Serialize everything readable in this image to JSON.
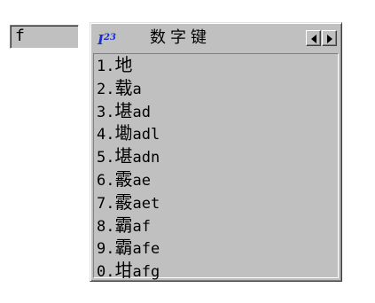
{
  "composition": {
    "text": "f"
  },
  "candidate_window": {
    "mode_icon_base": "I",
    "mode_icon_sup": "23",
    "title": "数字键",
    "nav": {
      "prev_icon": "triangle-left-icon",
      "next_icon": "triangle-right-icon"
    },
    "candidates": [
      {
        "num": "1.",
        "char": "地",
        "code": ""
      },
      {
        "num": "2.",
        "char": "载",
        "code": "a"
      },
      {
        "num": "3.",
        "char": "堪",
        "code": "ad"
      },
      {
        "num": "4.",
        "char": "墈",
        "code": "adl"
      },
      {
        "num": "5.",
        "char": "堪",
        "code": "adn"
      },
      {
        "num": "6.",
        "char": "霰",
        "code": "ae"
      },
      {
        "num": "7.",
        "char": "霰",
        "code": "aet"
      },
      {
        "num": "8.",
        "char": "霸",
        "code": "af"
      },
      {
        "num": "9.",
        "char": "霸",
        "code": "afe"
      },
      {
        "num": "0.",
        "char": "坩",
        "code": "afg"
      }
    ]
  }
}
